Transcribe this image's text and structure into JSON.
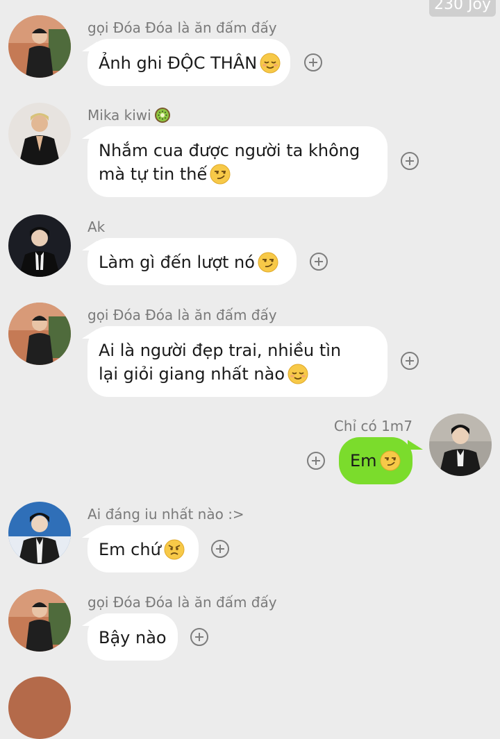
{
  "top_chip": "230 Joy",
  "messages": [
    {
      "sender": "gọi Đóa Đóa là ăn đấm đấy",
      "text": "Ảnh ghi ĐỘC THÂN",
      "emoji": "relieved-face",
      "side": "left"
    },
    {
      "sender": "Mika kiwi",
      "sender_emoji": "kiwi-fruit",
      "line1": "Nhắm cua được người ta không",
      "line2": "mà tự tin thế",
      "emoji": "smirking-face",
      "side": "left"
    },
    {
      "sender": "Ak",
      "text": "Làm gì đến lượt nó",
      "emoji": "smirking-face",
      "side": "left"
    },
    {
      "sender": "gọi Đóa Đóa là ăn đấm đấy",
      "line1": "Ai là người đẹp trai, nhiều tìn",
      "line2": "lại giỏi giang nhất nào",
      "emoji": "relieved-face",
      "side": "left"
    },
    {
      "sender": "Chỉ có 1m7",
      "text": "Em",
      "emoji": "smirking-face",
      "side": "right"
    },
    {
      "sender": "Ai đáng iu nhất nào :>",
      "text": "Em chứ",
      "emoji": "angry-face",
      "side": "left"
    },
    {
      "sender": "gọi Đóa Đóa là ăn đấm đấy",
      "text": "Bậy nào",
      "side": "left"
    }
  ],
  "colors": {
    "background": "#ececec",
    "own_bubble": "#7bdc2c",
    "other_bubble": "#ffffff",
    "name_text": "#7a7a7a"
  }
}
